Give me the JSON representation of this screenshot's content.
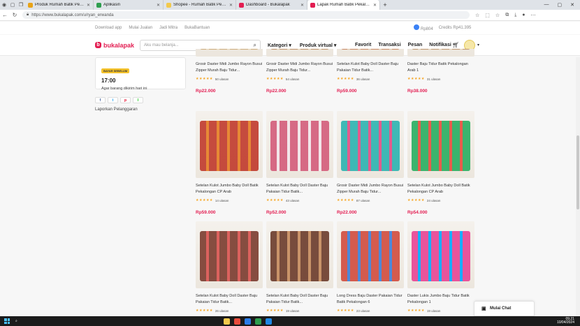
{
  "browser": {
    "tabs": [
      {
        "label": "Produk Rumah Batik Pekalongan",
        "color": "#e8a317"
      },
      {
        "label": "Aplikasin",
        "color": "#2e9e4f"
      },
      {
        "label": "Shopee - Rumah Batik Pekalong...",
        "color": "#f2c94c"
      },
      {
        "label": "Dashboard - Bukalapak",
        "color": "#e31e52"
      },
      {
        "label": "Lapak Rumah Batik Pekalongan",
        "color": "#e31e52",
        "active": true
      }
    ],
    "url": "https://www.bukalapak.com/u/ryan_erwanda"
  },
  "topstrip": {
    "links": [
      "Download app",
      "Mulai Jualan",
      "Jadi Mitra",
      "BukaBantuan"
    ],
    "balance": "Rp804",
    "credits": "Credits Rp41.395"
  },
  "header": {
    "logo": "bukalapak",
    "search_placeholder": "Aku mau belanja...",
    "nav": [
      "Kategori",
      "Produk virtual"
    ],
    "links": [
      "Favorit",
      "Transaksi",
      "Pesan",
      "Notifikasi"
    ]
  },
  "sidebar": {
    "badge": "BAYAR SEBELUM",
    "time": "17:00",
    "shipping_note": "Agar barang dikirim hari ini",
    "share_icons": [
      "f",
      "t",
      "p",
      "l"
    ],
    "report_link": "Laporkan Pelanggaran"
  },
  "products": [
    {
      "name": "Grosir Daster Midi Jumbo Rayon Busui Zipper Murah Baju Tidur...",
      "stars": "★★★★★",
      "reviews": "50 ulasan",
      "price": "Rp22.000",
      "colors": [
        "#c9a46d",
        "#e8d2b0"
      ]
    },
    {
      "name": "Grosir Daster Midi Jumbo Rayon Busui Zipper Murah Baju Tidur...",
      "stars": "★★★★★",
      "reviews": "54 ulasan",
      "price": "Rp22.000",
      "colors": [
        "#b8875a",
        "#e5cfaa"
      ]
    },
    {
      "name": "Setelan Kulot Baby Doll Daster Baju Pakaian Tidur Batik...",
      "stars": "★★★★★",
      "reviews": "36 ulasan",
      "price": "Rp59.000",
      "colors": [
        "#c47b52",
        "#dcc2a1"
      ]
    },
    {
      "name": "Daster Baju Tidur Batik Pekalongan Arab 1",
      "stars": "★★★★★",
      "reviews": "31 ulasan",
      "price": "Rp38.000",
      "colors": [
        "#b98a5e",
        "#e2cdb0"
      ]
    },
    {
      "name": "Setelan Kulot Jumbo Baby Doll Batik Pekalongan CP Arab",
      "stars": "★★★★★",
      "reviews": "14 ulasan",
      "price": "Rp59.000",
      "colors": [
        "#c0392b",
        "#e67e22"
      ]
    },
    {
      "name": "Setelan Kulot Baby Doll Daster Baju Pakaian Tidur Batik...",
      "stars": "★★★★★",
      "reviews": "43 ulasan",
      "price": "Rp52.000",
      "colors": [
        "#d35b7a",
        "#f2e6ea"
      ]
    },
    {
      "name": "Grosir Daster Midi Jumbo Rayon Busui Zipper Murah Baju Tidur...",
      "stars": "★★★★★",
      "reviews": "87 ulasan",
      "price": "Rp22.000",
      "colors": [
        "#2bb3b0",
        "#e04c84"
      ]
    },
    {
      "name": "Setelan Kulot Jumbo Baby Doll Batik Pekalongan CP Arab",
      "stars": "★★★★★",
      "reviews": "24 ulasan",
      "price": "Rp54.000",
      "colors": [
        "#27ae60",
        "#e74c3c"
      ]
    },
    {
      "name": "Setelan Kulot Baby Doll Daster Baju Pakaian Tidur Batik...",
      "stars": "★★★★★",
      "reviews": "26 ulasan",
      "price": "Rp59.000",
      "colors": [
        "#7a3b2e",
        "#d9534f"
      ]
    },
    {
      "name": "Setelan Kulot Baby Doll Daster Baju Pakaian Tidur Batik...",
      "stars": "★★★★★",
      "reviews": "19 ulasan",
      "price": "Rp59.000",
      "colors": [
        "#6b3a2a",
        "#c58a5c"
      ]
    },
    {
      "name": "Long Dress Baju Daster Pakaian Tidur Batik Pekalongan 6",
      "stars": "★★★★★",
      "reviews": "23 ulasan",
      "price": "Rp38.000",
      "colors": [
        "#d14b3d",
        "#3b7dd8"
      ]
    },
    {
      "name": "Daster Lukis Jumbo Baju Tidur Batik Pekalongan 1",
      "stars": "★★★★★",
      "reviews": "19 ulasan",
      "price": "Rp38.000",
      "colors": [
        "#e84393",
        "#00a8ff"
      ]
    }
  ],
  "chat": {
    "label": "Mulai Chat"
  },
  "taskbar": {
    "time": "09.21",
    "date": "10/04/2024"
  }
}
